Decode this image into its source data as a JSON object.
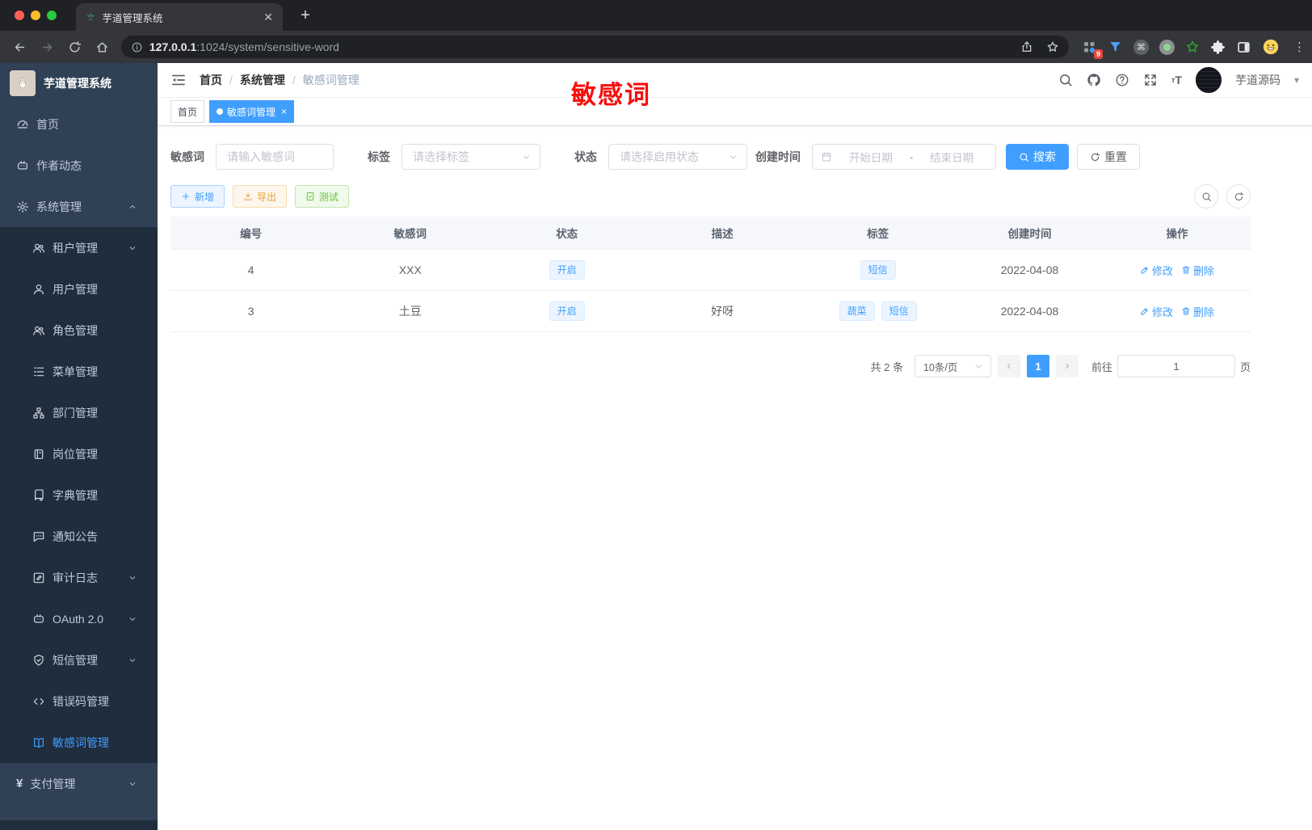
{
  "browser": {
    "tab_title": "芋道管理系统",
    "url_host": "127.0.0.1",
    "url_path": ":1024/system/sensitive-word",
    "ext_badge": "9"
  },
  "sidebar": {
    "app_title": "芋道管理系统",
    "menu": [
      {
        "label": "首页",
        "icon": "dashboard",
        "level": 1
      },
      {
        "label": "作者动态",
        "icon": "robot",
        "level": 1
      },
      {
        "label": "系统管理",
        "icon": "gear",
        "level": 1,
        "arrow": "up"
      },
      {
        "label": "租户管理",
        "icon": "users",
        "level": 2,
        "arrow": "down"
      },
      {
        "label": "用户管理",
        "icon": "user",
        "level": 2
      },
      {
        "label": "角色管理",
        "icon": "users",
        "level": 2
      },
      {
        "label": "菜单管理",
        "icon": "menu-list",
        "level": 2
      },
      {
        "label": "部门管理",
        "icon": "org",
        "level": 2
      },
      {
        "label": "岗位管理",
        "icon": "badge",
        "level": 2
      },
      {
        "label": "字典管理",
        "icon": "book",
        "level": 2
      },
      {
        "label": "通知公告",
        "icon": "comment",
        "level": 2
      },
      {
        "label": "审计日志",
        "icon": "audit",
        "level": 2,
        "arrow": "down"
      },
      {
        "label": "OAuth 2.0",
        "icon": "robot",
        "level": 2,
        "arrow": "down"
      },
      {
        "label": "短信管理",
        "icon": "shield",
        "level": 2,
        "arrow": "down"
      },
      {
        "label": "错误码管理",
        "icon": "code",
        "level": 2
      },
      {
        "label": "敏感词管理",
        "icon": "open-book",
        "level": 2,
        "active": true
      },
      {
        "label": "支付管理",
        "icon": "yen",
        "level": 1,
        "arrow": "down"
      }
    ]
  },
  "header": {
    "breadcrumb": [
      "首页",
      "系统管理",
      "敏感词管理"
    ],
    "user_name": "芋道源码",
    "annotation": "敏感词",
    "annotation_color": "#f70f0f"
  },
  "tags_view": [
    {
      "label": "首页",
      "active": false
    },
    {
      "label": "敏感词管理",
      "active": true,
      "closable": true
    }
  ],
  "filters": {
    "keyword_label": "敏感词",
    "keyword_placeholder": "请输入敏感词",
    "tag_label": "标签",
    "tag_placeholder": "请选择标签",
    "status_label": "状态",
    "status_placeholder": "请选择启用状态",
    "date_label": "创建时间",
    "date_start": "开始日期",
    "date_sep": "-",
    "date_end": "结束日期",
    "search": "搜索",
    "reset": "重置"
  },
  "toolbar": {
    "add": "新增",
    "export": "导出",
    "test": "测试"
  },
  "table": {
    "columns": [
      "编号",
      "敏感词",
      "状态",
      "描述",
      "标签",
      "创建时间",
      "操作"
    ],
    "rows": [
      {
        "id": "4",
        "word": "XXX",
        "status": "开启",
        "desc": "",
        "tags": [
          "短信"
        ],
        "created": "2022-04-08"
      },
      {
        "id": "3",
        "word": "土豆",
        "status": "开启",
        "desc": "好呀",
        "tags": [
          "蔬菜",
          "短信"
        ],
        "created": "2022-04-08"
      }
    ],
    "edit_label": "修改",
    "delete_label": "删除"
  },
  "pagination": {
    "total": "共 2 条",
    "size": "10条/页",
    "page": "1",
    "goto_label": "前往",
    "goto_value": "1",
    "unit_label": "页"
  },
  "colors": {
    "accent": "#409eff",
    "sidebar_bg": "#304156",
    "submenu_bg": "#1f2d3d",
    "warning": "#e6a23c",
    "success": "#67c23a"
  }
}
